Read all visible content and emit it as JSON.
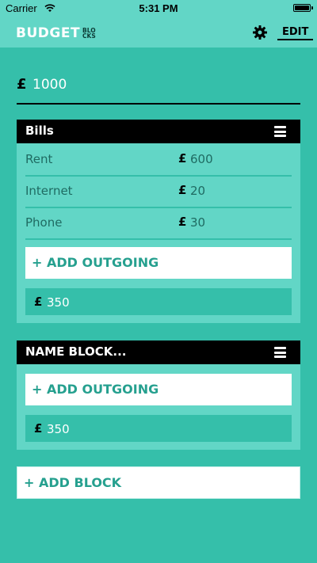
{
  "status_bar": {
    "carrier": "Carrier",
    "time": "5:31 PM"
  },
  "nav": {
    "logo_main": "BUDGET",
    "logo_small_line1": "BLO",
    "logo_small_line2": "CKS",
    "edit_label": "EDIT",
    "settings_icon": "gear-icon"
  },
  "budget": {
    "currency": "£",
    "value": "1000"
  },
  "blocks": [
    {
      "title": "Bills",
      "items": [
        {
          "name": "Rent",
          "currency": "£",
          "amount": "600"
        },
        {
          "name": "Internet",
          "currency": "£",
          "amount": "20"
        },
        {
          "name": "Phone",
          "currency": "£",
          "amount": "30"
        }
      ],
      "add_label": "+ ADD OUTGOING",
      "total_currency": "£",
      "total": "350"
    },
    {
      "title": "NAME BLOCK...",
      "items": [],
      "add_label": "+ ADD OUTGOING",
      "total_currency": "£",
      "total": "350"
    }
  ],
  "add_block_label": "+ ADD BLOCK",
  "colors": {
    "background": "#35bfaa",
    "panel": "#62d6c6",
    "header": "#000000",
    "accent_text": "#26a08f"
  }
}
